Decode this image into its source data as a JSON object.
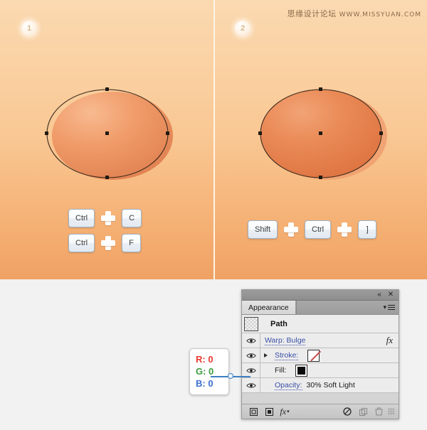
{
  "watermark": {
    "cn": "思缘设计论坛",
    "en": "WWW.MISSYUAN.COM"
  },
  "panels": [
    {
      "step": "1",
      "key_rows": [
        {
          "keys": [
            "Ctrl",
            "C"
          ]
        },
        {
          "keys": [
            "Ctrl",
            "F"
          ]
        }
      ]
    },
    {
      "step": "2",
      "key_rows": [
        {
          "keys": [
            "Shift",
            "Ctrl",
            "]"
          ]
        }
      ]
    }
  ],
  "appearance_panel": {
    "tab_label": "Appearance",
    "titlebar": {
      "collapse_icon": "collapse-double-left-icon",
      "close_icon": "close-icon"
    },
    "menu_icon": "panel-menu-icon",
    "rows": [
      {
        "name": "path",
        "label": "Path",
        "thumbnail": "path-thumbnail",
        "has_eye": false
      },
      {
        "name": "warp",
        "label": "Warp: Bulge",
        "has_eye": true,
        "fx": "fx"
      },
      {
        "name": "stroke",
        "label": "Stroke:",
        "has_eye": true,
        "has_disclosure": true,
        "swatch": "none-swatch"
      },
      {
        "name": "fill",
        "label": "Fill:",
        "has_eye": true,
        "swatch": "black-swatch"
      },
      {
        "name": "opacity",
        "label": "Opacity:",
        "value": "30% Soft Light",
        "has_eye": true
      }
    ],
    "footer_buttons": [
      {
        "name": "add-new-stroke-button",
        "glyph": "▫"
      },
      {
        "name": "add-new-fill-button",
        "glyph": "▪"
      },
      {
        "name": "add-new-effect-button",
        "glyph": "fx"
      },
      {
        "name": "clear-appearance-button",
        "glyph": "⊘"
      },
      {
        "name": "duplicate-item-button",
        "glyph": "❐"
      },
      {
        "name": "delete-item-button",
        "glyph": "🗑"
      }
    ]
  },
  "rgb_callout": {
    "r": "R: 0",
    "g": "G: 0",
    "b": "B: 0",
    "colors": {
      "r": "#e8392f",
      "g": "#3c9a3c",
      "b": "#3c6fd0"
    }
  },
  "theme": {
    "background_top": "#fbd9b1",
    "background_bottom": "#efa164",
    "shape_fill_light": "#f2a071",
    "shape_fill_dark": "#e07a4a",
    "link_color": "#3a4fa8"
  }
}
